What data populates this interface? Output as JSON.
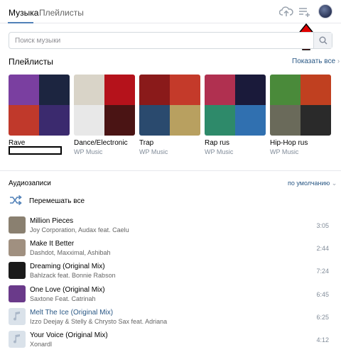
{
  "tabs": {
    "music": "Музыка",
    "playlists": "Плейлисты"
  },
  "search": {
    "placeholder": "Поиск музыки"
  },
  "playlists_section": {
    "title": "Плейлисты",
    "show_all": "Показать все",
    "items": [
      {
        "title": "Rave",
        "subtitle": "",
        "colors": [
          "#7a3fa0",
          "#1c2540",
          "#c0392b",
          "#3b2a6e"
        ]
      },
      {
        "title": "Dance/Electronic",
        "subtitle": "WP Music",
        "colors": [
          "#d9d4c8",
          "#b5121b",
          "#e8e8e8",
          "#4a1414"
        ]
      },
      {
        "title": "Trap",
        "subtitle": "WP Music",
        "colors": [
          "#8a1a1a",
          "#c43a2a",
          "#2a4a6e",
          "#b8a060"
        ]
      },
      {
        "title": "Rap rus",
        "subtitle": "WP Music",
        "colors": [
          "#b03050",
          "#1a1a3a",
          "#2e8a6a",
          "#3070b0"
        ]
      },
      {
        "title": "Hip-Hop rus",
        "subtitle": "WP Music",
        "colors": [
          "#4a8a3a",
          "#c04020",
          "#6a6a5a",
          "#2a2a2a"
        ]
      }
    ]
  },
  "audio_section": {
    "title": "Аудиозаписи",
    "sort": "по умолчанию",
    "shuffle_label": "Перемешать все"
  },
  "tracks": [
    {
      "title": "Million Pieces",
      "artist": "Joy Corporation, Audax feat. Caelu",
      "duration": "3:05",
      "thumb": "#8a8070",
      "note": false,
      "active": false
    },
    {
      "title": "Make It Better",
      "artist": "Dashdot, Maxximal, Ashibah",
      "duration": "2:44",
      "thumb": "#a09080",
      "note": false,
      "active": false
    },
    {
      "title": "Dreaming (Original Mix)",
      "artist": "Bahlzack feat. Bonnie Rabson",
      "duration": "7:24",
      "thumb": "#1a1a1a",
      "note": false,
      "active": false
    },
    {
      "title": "One Love (Original Mix)",
      "artist": "Saxtone Feat. Catrinah",
      "duration": "6:45",
      "thumb": "#6a3a8a",
      "note": false,
      "active": false
    },
    {
      "title": "Melt The Ice (Original Mix)",
      "artist": "Izzo Deejay & Stelly & Chrysto Sax feat. Adriana",
      "duration": "6:25",
      "thumb": "",
      "note": true,
      "active": true
    },
    {
      "title": "Your Voice (Original Mix)",
      "artist": "Xonardl",
      "duration": "4:12",
      "thumb": "",
      "note": true,
      "active": false
    }
  ],
  "colors": {
    "accent": "#5181b8",
    "link": "#2a5885",
    "arrow": "#e00000"
  }
}
